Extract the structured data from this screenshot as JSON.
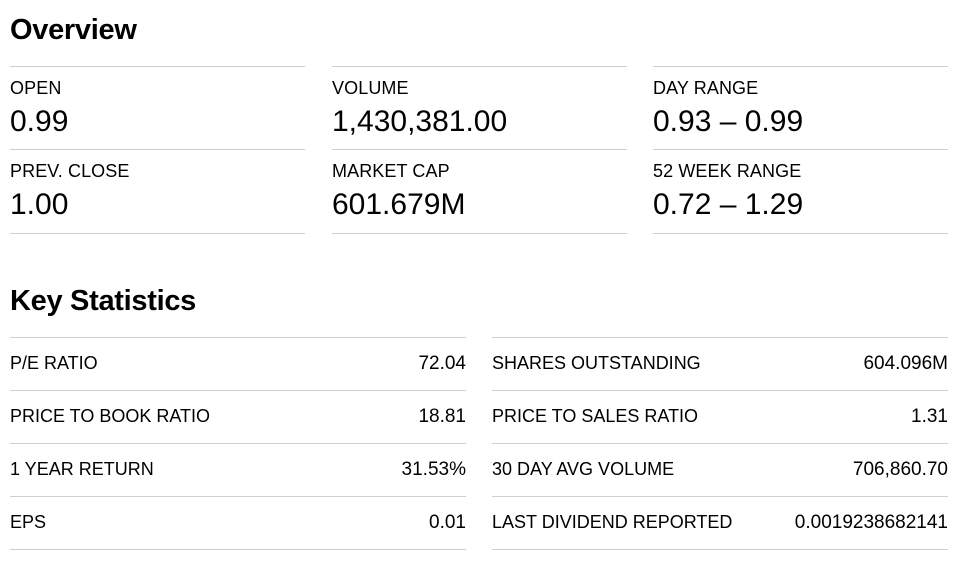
{
  "overview": {
    "title": "Overview",
    "cells": [
      {
        "label": "OPEN",
        "value": "0.99"
      },
      {
        "label": "VOLUME",
        "value": "1,430,381.00"
      },
      {
        "label": "DAY RANGE",
        "value": "0.93 – 0.99"
      },
      {
        "label": "PREV. CLOSE",
        "value": "1.00"
      },
      {
        "label": "MARKET CAP",
        "value": "601.679M"
      },
      {
        "label": "52 WEEK RANGE",
        "value": "0.72 – 1.29"
      }
    ]
  },
  "key_statistics": {
    "title": "Key Statistics",
    "left": [
      {
        "label": "P/E RATIO",
        "value": "72.04"
      },
      {
        "label": "PRICE TO BOOK RATIO",
        "value": "18.81"
      },
      {
        "label": "1 YEAR RETURN",
        "value": "31.53%"
      },
      {
        "label": "EPS",
        "value": "0.01"
      }
    ],
    "right": [
      {
        "label": "SHARES OUTSTANDING",
        "value": "604.096M"
      },
      {
        "label": "PRICE TO SALES RATIO",
        "value": "1.31"
      },
      {
        "label": "30 DAY AVG VOLUME",
        "value": "706,860.70"
      },
      {
        "label": "LAST DIVIDEND REPORTED",
        "value": "0.0019238682141"
      }
    ]
  }
}
